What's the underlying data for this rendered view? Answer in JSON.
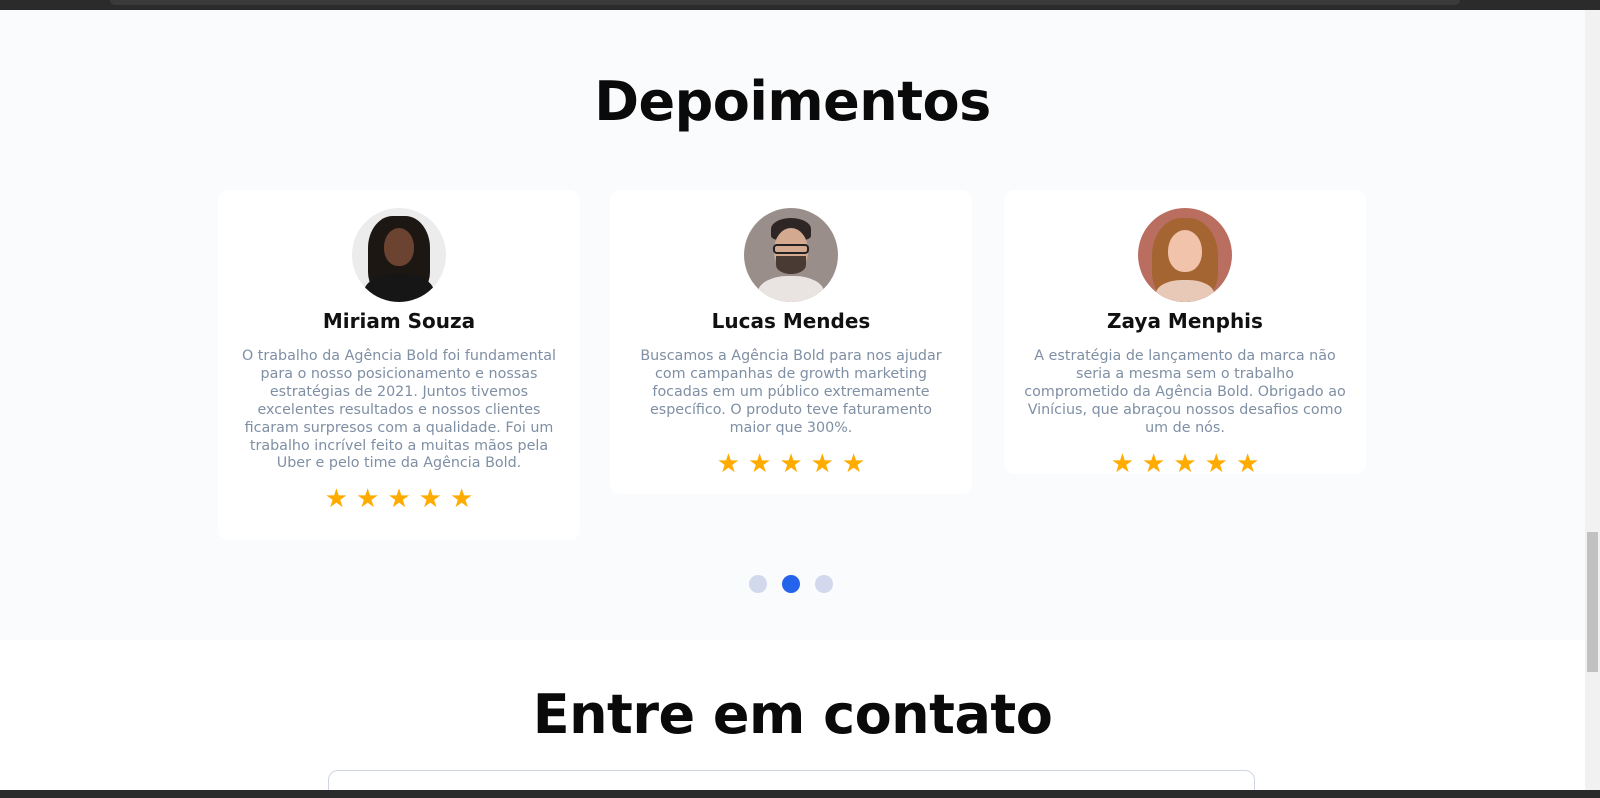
{
  "testimonials": {
    "title": "Depoimentos",
    "cards": [
      {
        "name": "Miriam Souza",
        "text": "O trabalho da Agência Bold foi fundamental para o nosso posicionamento e nossas estratégias de 2021. Juntos tivemos excelentes resultados e nossos clientes ficaram surpresos com a qualidade. Foi um trabalho incrível feito a muitas mãos pela Uber e pelo time da Agência Bold.",
        "rating": 5
      },
      {
        "name": "Lucas Mendes",
        "text": "Buscamos a Agência Bold para nos ajudar com campanhas de growth marketing focadas em um público extremamente específico. O produto teve faturamento maior que 300%.",
        "rating": 5
      },
      {
        "name": "Zaya Menphis",
        "text": "A estratégia de lançamento da marca não seria a mesma sem o trabalho comprometido da Agência Bold. Obrigado ao Vinícius, que abraçou nossos desafios como um de nós.",
        "rating": 5
      }
    ],
    "carousel": {
      "total_pages": 3,
      "active_page": 2
    }
  },
  "contact": {
    "title": "Entre em contato"
  },
  "colors": {
    "star": "#ffab00",
    "dot_active": "#2563eb",
    "dot_inactive": "#d2d9ec",
    "text_muted": "#7f8fa4",
    "section_bg": "#f9fbfd"
  },
  "icons": {
    "star": "star-icon"
  }
}
